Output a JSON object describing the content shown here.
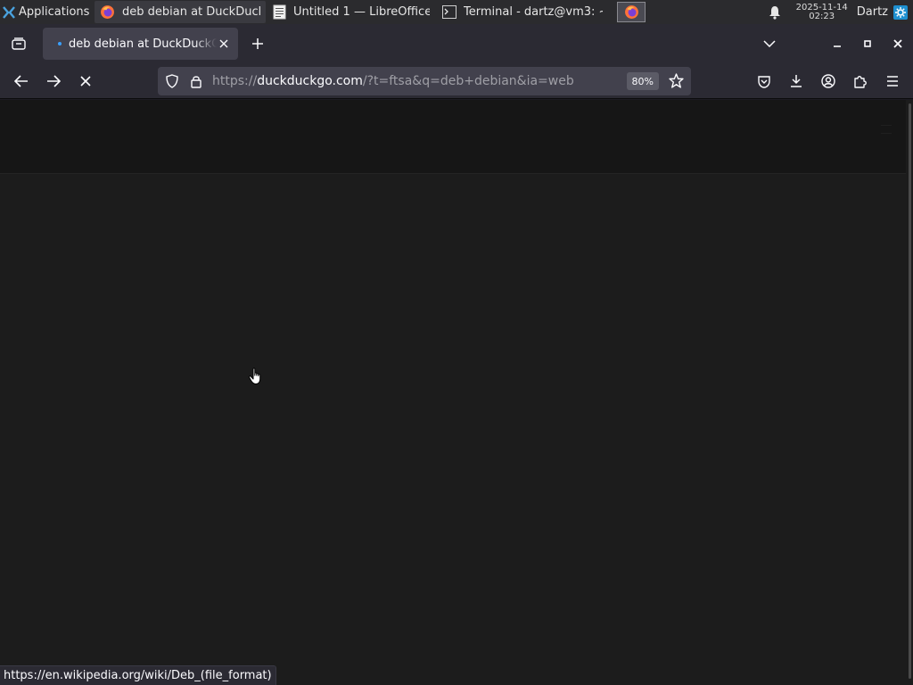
{
  "taskbar": {
    "applications_label": "Applications",
    "tasks": [
      {
        "label": "deb debian at DuckDuck...",
        "icon": "firefox-icon"
      },
      {
        "label": "Untitled 1 — LibreOffice ...",
        "icon": "document-icon"
      },
      {
        "label": "Terminal - dartz@vm3: ~",
        "icon": "terminal-icon"
      }
    ],
    "clock_date": "2025-11-14",
    "clock_time": "02:23",
    "user": "Dartz"
  },
  "browser": {
    "tab_title": "deb debian at DuckDuckGo",
    "url_scheme": "https://",
    "url_host": "duckduckgo.com",
    "url_path": "/?t=ftsa&q=deb+debian&ia=web",
    "zoom": "80%",
    "status_link": "https://en.wikipedia.org/wiki/Deb_(file_format)"
  },
  "colors": {
    "chrome": "#2b2a33",
    "tab_active": "#42414d",
    "content_bg": "#1c1c1c",
    "loading_dot": "#3aa0ff"
  }
}
